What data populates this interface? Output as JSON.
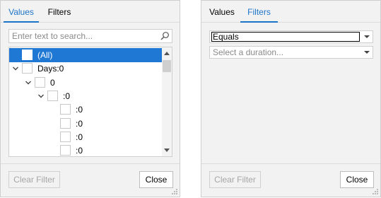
{
  "left_panel": {
    "tabs": [
      {
        "label": "Values",
        "active": true
      },
      {
        "label": "Filters",
        "active": false
      }
    ],
    "search": {
      "placeholder": "Enter text to search...",
      "value": ""
    },
    "tree": [
      {
        "label": "(All)",
        "selected": true,
        "expand": "none",
        "level": 0
      },
      {
        "label": "Days:0",
        "selected": false,
        "expand": "expanded",
        "level": 0
      },
      {
        "label": "0",
        "selected": false,
        "expand": "expanded",
        "level": 1
      },
      {
        "label": ":0",
        "selected": false,
        "expand": "expanded",
        "level": 2
      },
      {
        "label": ":0",
        "selected": false,
        "expand": "none",
        "level": 3
      },
      {
        "label": ":0",
        "selected": false,
        "expand": "none",
        "level": 3
      },
      {
        "label": ":0",
        "selected": false,
        "expand": "none",
        "level": 3
      },
      {
        "label": ":0",
        "selected": false,
        "expand": "none",
        "level": 3
      }
    ],
    "buttons": {
      "clear_filter": "Clear Filter",
      "close": "Close"
    },
    "clear_filter_enabled": false
  },
  "right_panel": {
    "tabs": [
      {
        "label": "Values",
        "active": false
      },
      {
        "label": "Filters",
        "active": true
      }
    ],
    "operator": {
      "value": "Equals"
    },
    "duration": {
      "placeholder": "Select a duration..."
    },
    "buttons": {
      "clear_filter": "Clear Filter",
      "close": "Close"
    },
    "clear_filter_enabled": false
  },
  "colors": {
    "accent": "#1c74c9",
    "selection": "#1e78d4",
    "panel_background": "#f2f2f2",
    "border": "#cfcfcf",
    "disabled_text": "#a6a6a6"
  },
  "icons": {
    "search": "magnifier-icon",
    "expand": "chevron-down-icon",
    "dropdown": "caret-down-icon",
    "scroll_up": "triangle-up-icon",
    "scroll_down": "triangle-down-icon",
    "resize": "size-grip-icon"
  }
}
